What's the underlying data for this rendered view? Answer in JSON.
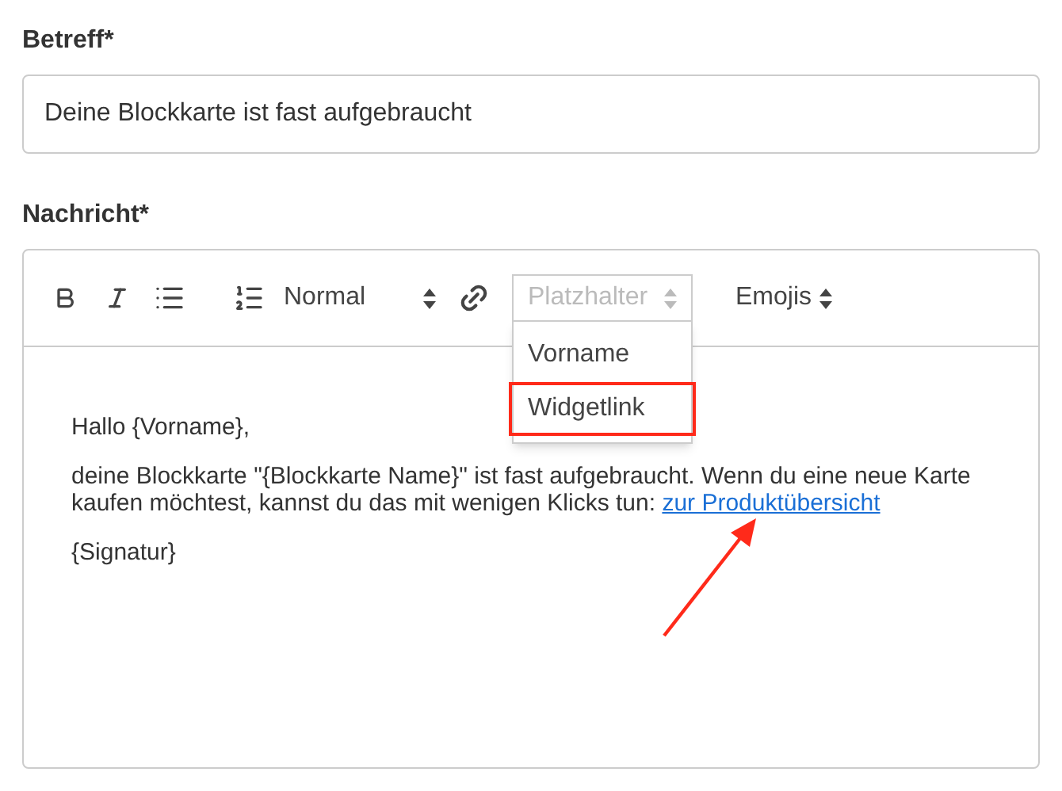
{
  "subject": {
    "label": "Betreff*",
    "value": "Deine Blockkarte ist fast aufgebraucht"
  },
  "message": {
    "label": "Nachricht*",
    "toolbar": {
      "format_select": {
        "value": "Normal"
      },
      "placeholder_select": {
        "placeholder": "Platzhalter",
        "expanded": true,
        "options": [
          {
            "label": "Vorname",
            "highlighted": false
          },
          {
            "label": "Widgetlink",
            "highlighted": true
          }
        ]
      },
      "emoji_select": {
        "label": "Emojis"
      }
    },
    "body": [
      {
        "kind": "text",
        "text": "Hallo {Vorname},"
      },
      {
        "kind": "link_paragraph",
        "text": "deine Blockkarte \"{Blockkarte Name}\" ist fast aufgebraucht. Wenn du eine neue Karte kaufen möchtest, kannst du das mit wenigen Klicks tun:",
        "link": "zur Produktübersicht"
      },
      {
        "kind": "text",
        "text": "{Signatur}"
      }
    ]
  }
}
